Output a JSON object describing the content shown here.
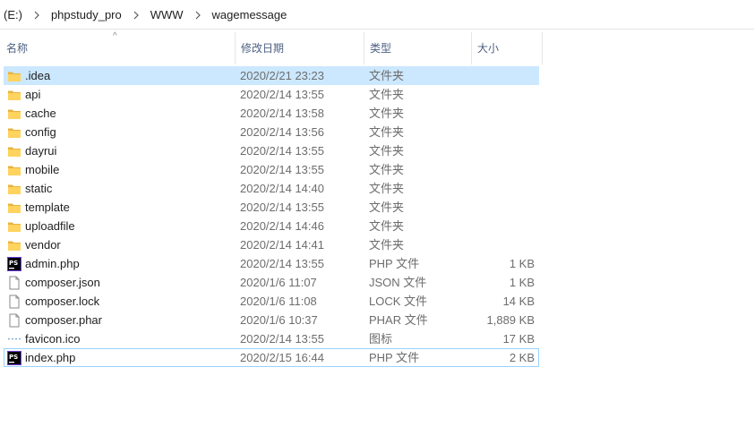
{
  "breadcrumb": {
    "drive": "(E:)",
    "path": [
      "phpstudy_pro",
      "WWW",
      "wagemessage"
    ]
  },
  "columns": {
    "name": "名称",
    "date": "修改日期",
    "type": "类型",
    "size": "大小"
  },
  "files": [
    {
      "name": ".idea",
      "date": "2020/2/21 23:23",
      "type": "文件夹",
      "size": "",
      "icon": "folder-icon"
    },
    {
      "name": "api",
      "date": "2020/2/14 13:55",
      "type": "文件夹",
      "size": "",
      "icon": "folder-icon"
    },
    {
      "name": "cache",
      "date": "2020/2/14 13:58",
      "type": "文件夹",
      "size": "",
      "icon": "folder-icon"
    },
    {
      "name": "config",
      "date": "2020/2/14 13:56",
      "type": "文件夹",
      "size": "",
      "icon": "folder-icon"
    },
    {
      "name": "dayrui",
      "date": "2020/2/14 13:55",
      "type": "文件夹",
      "size": "",
      "icon": "folder-icon"
    },
    {
      "name": "mobile",
      "date": "2020/2/14 13:55",
      "type": "文件夹",
      "size": "",
      "icon": "folder-icon"
    },
    {
      "name": "static",
      "date": "2020/2/14 14:40",
      "type": "文件夹",
      "size": "",
      "icon": "folder-icon"
    },
    {
      "name": "template",
      "date": "2020/2/14 13:55",
      "type": "文件夹",
      "size": "",
      "icon": "folder-icon"
    },
    {
      "name": "uploadfile",
      "date": "2020/2/14 14:46",
      "type": "文件夹",
      "size": "",
      "icon": "folder-icon"
    },
    {
      "name": "vendor",
      "date": "2020/2/14 14:41",
      "type": "文件夹",
      "size": "",
      "icon": "folder-icon"
    },
    {
      "name": "admin.php",
      "date": "2020/2/14 13:55",
      "type": "PHP 文件",
      "size": "1 KB",
      "icon": "phpstorm-file-icon"
    },
    {
      "name": "composer.json",
      "date": "2020/1/6 11:07",
      "type": "JSON 文件",
      "size": "1 KB",
      "icon": "blank-file-icon"
    },
    {
      "name": "composer.lock",
      "date": "2020/1/6 11:08",
      "type": "LOCK 文件",
      "size": "14 KB",
      "icon": "blank-file-icon"
    },
    {
      "name": "composer.phar",
      "date": "2020/1/6 10:37",
      "type": "PHAR 文件",
      "size": "1,889 KB",
      "icon": "blank-file-icon"
    },
    {
      "name": "favicon.ico",
      "date": "2020/2/14 13:55",
      "type": "图标",
      "size": "17 KB",
      "icon": "ico-file-icon"
    },
    {
      "name": "index.php",
      "date": "2020/2/15 16:44",
      "type": "PHP 文件",
      "size": "2 KB",
      "icon": "phpstorm-file-icon"
    }
  ],
  "selected_index": 0,
  "focused_index": 15
}
